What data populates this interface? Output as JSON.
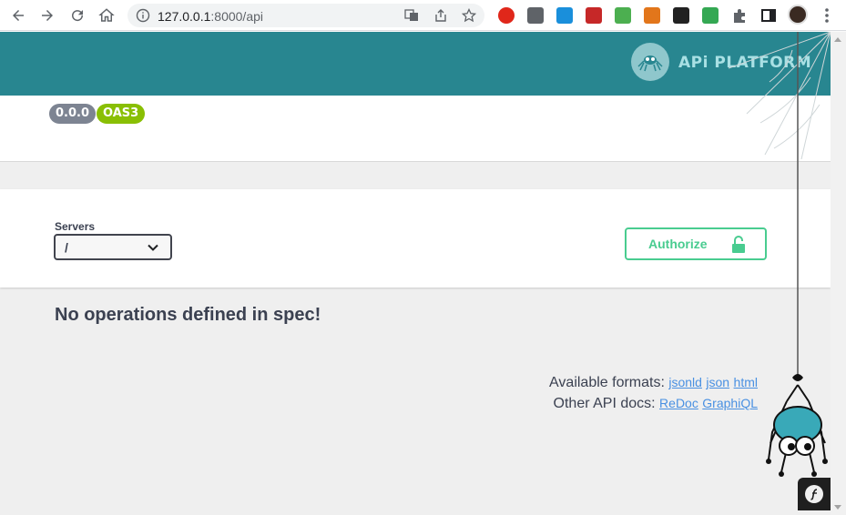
{
  "browser": {
    "url_host": "127.0.0.1",
    "url_path": ":8000/api"
  },
  "header": {
    "logo_text": "APi PLATFORM"
  },
  "info": {
    "version_badge": "0.0.0",
    "oas_badge": "OAS3"
  },
  "servers": {
    "label": "Servers",
    "selected": "/"
  },
  "authorize": {
    "label": "Authorize"
  },
  "operations": {
    "empty_message": "No operations defined in spec!"
  },
  "footer": {
    "formats_label": "Available formats:",
    "formats": [
      "jsonld",
      "json",
      "html"
    ],
    "docs_label": "Other API docs:",
    "docs": [
      "ReDoc",
      "GraphiQL"
    ]
  },
  "colors": {
    "header": "#288690",
    "authorize": "#49cc90",
    "version_badge": "#7d8492",
    "oas_badge": "#89bf04"
  }
}
